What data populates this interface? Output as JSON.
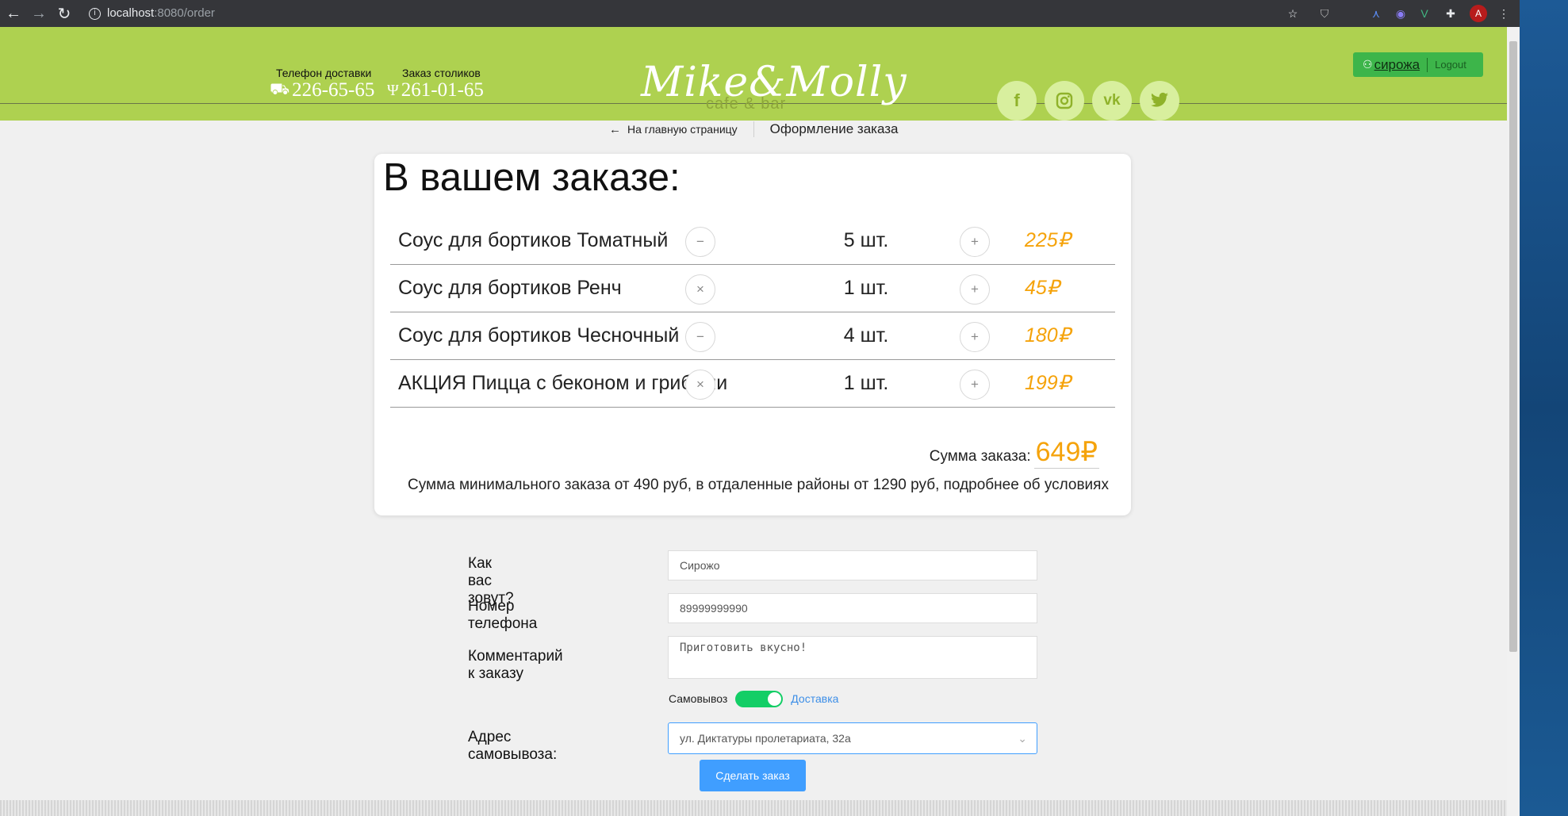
{
  "browser": {
    "url_host": "localhost",
    "url_path": ":8080/order",
    "avatar_letter": "A"
  },
  "header": {
    "delivery_phone_label": "Телефон доставки",
    "delivery_phone": "226-65-65",
    "table_order_label": "Заказ столиков",
    "table_phone": "261-01-65",
    "logo_script": "Mike&Molly",
    "logo_sub": "cafe & bar",
    "user_name": "сирожа",
    "logout_label": "Logout",
    "social": [
      "facebook",
      "instagram",
      "vk",
      "twitter"
    ]
  },
  "breadcrumb": {
    "back_label": "На главную страницу",
    "current": "Оформление заказа"
  },
  "order": {
    "title": "В вашем заказе:",
    "items": [
      {
        "name": "Соус для бортиков Томатный",
        "qty": "5 шт.",
        "price": "225₽",
        "minus": "−"
      },
      {
        "name": "Соус для бортиков Ренч",
        "qty": "1 шт.",
        "price": "45₽",
        "minus": "×"
      },
      {
        "name": "Соус для бортиков Чесночный",
        "qty": "4 шт.",
        "price": "180₽",
        "minus": "−"
      },
      {
        "name": "АКЦИЯ Пицца с беконом и грибами",
        "qty": "1 шт.",
        "price": "199₽",
        "minus": "×"
      }
    ],
    "plus": "+",
    "total_label": "Сумма заказа:",
    "total_value": "649₽",
    "minimum_note": "Сумма минимального заказа от 490 руб, в отдаленные районы от 1290 руб, подробнее об условиях"
  },
  "form": {
    "name_label": "Как вас зовут?",
    "name_value": "Сирожо",
    "phone_label": "Номер телефона",
    "phone_value": "89999999990",
    "comment_label": "Комментарий к заказу",
    "comment_value": "Приготовить вкусно!",
    "toggle_left": "Самовывоз",
    "toggle_right": "Доставка",
    "address_label": "Адрес самовывоза:",
    "address_value": "ул. Диктатуры пролетариата, 32а",
    "submit_label": "Сделать заказ"
  },
  "colors": {
    "header_green": "#aed150",
    "price_orange": "#f5a30b",
    "toggle_green": "#13ce66",
    "button_blue": "#409eff"
  }
}
